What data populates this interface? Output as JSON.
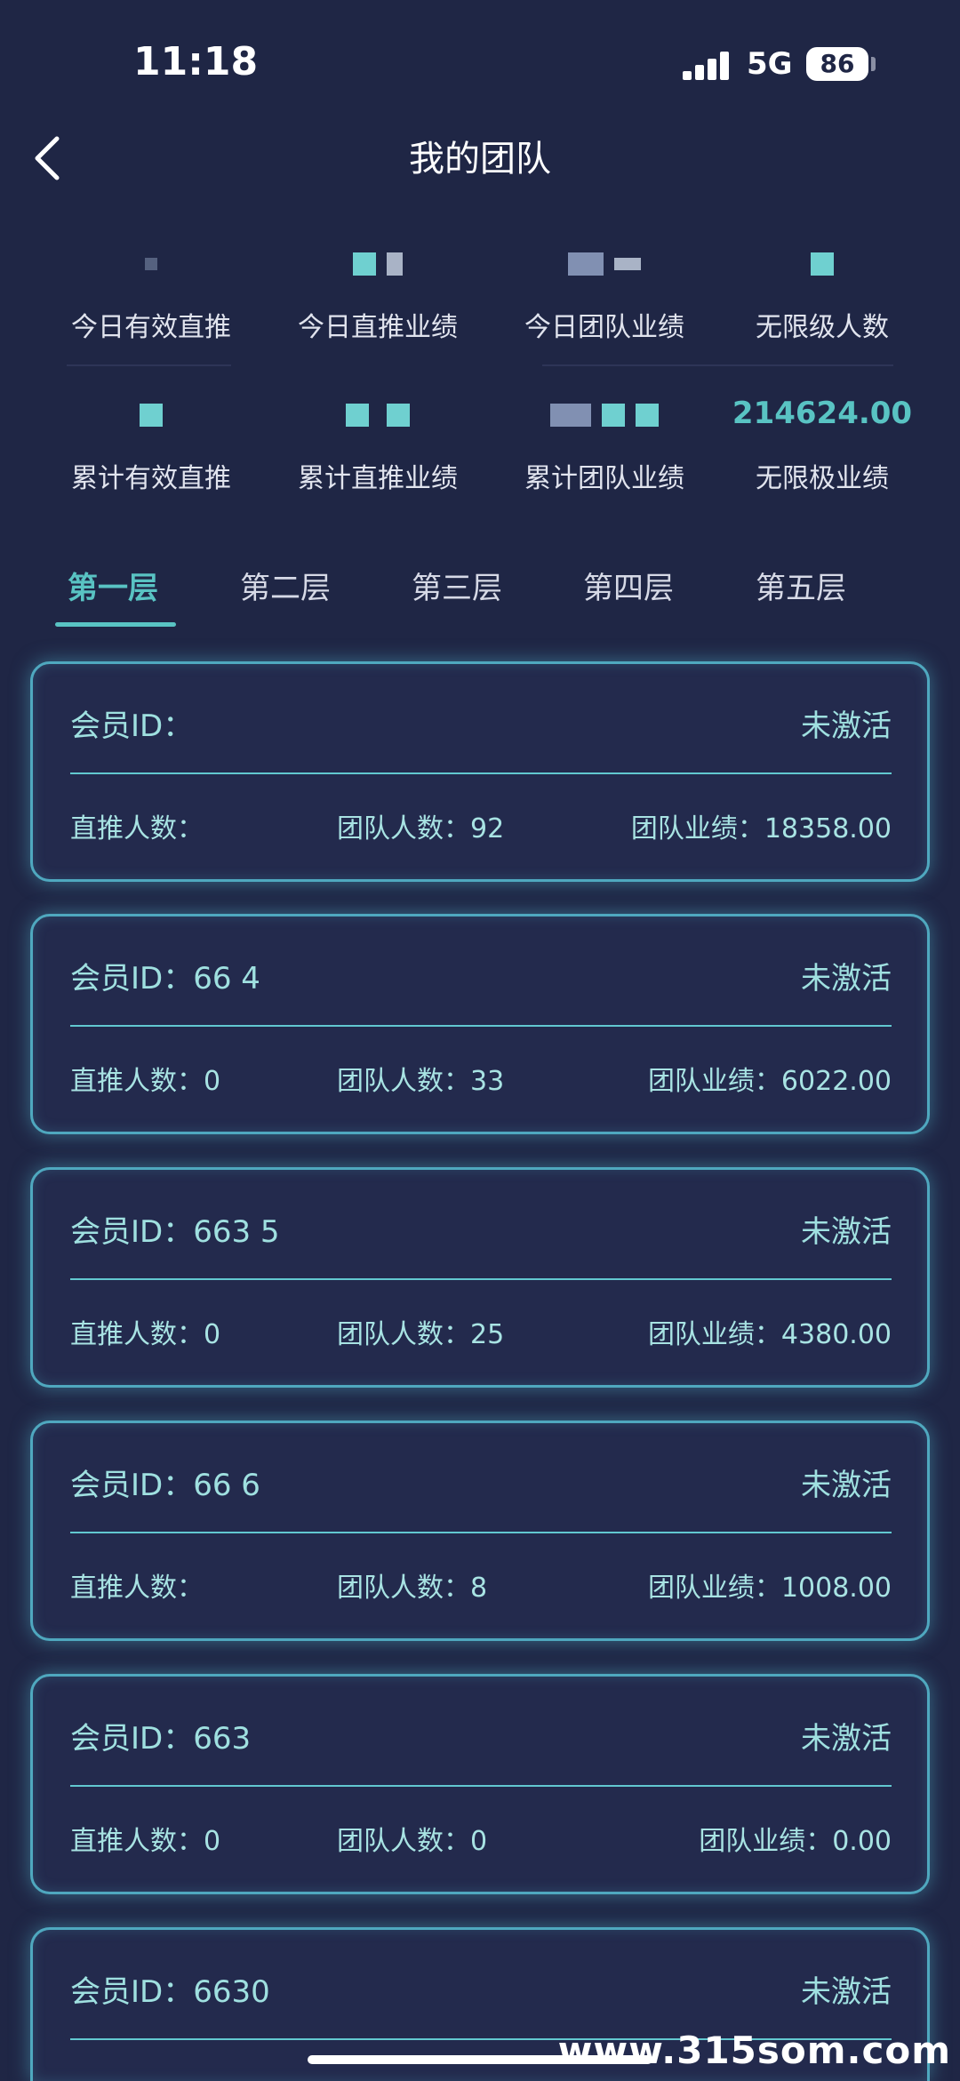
{
  "status_bar": {
    "time": "11:18",
    "network": "5G",
    "battery": "86"
  },
  "nav": {
    "title": "我的团队"
  },
  "stats": {
    "row1": [
      {
        "label": "今日有效直推",
        "value": ""
      },
      {
        "label": "今日直推业绩",
        "value": ""
      },
      {
        "label": "今日团队业绩",
        "value": ""
      },
      {
        "label": "无限级人数",
        "value": ""
      }
    ],
    "row2": [
      {
        "label": "累计有效直推",
        "value": ""
      },
      {
        "label": "累计直推业绩",
        "value": ""
      },
      {
        "label": "累计团队业绩",
        "value": ""
      },
      {
        "label": "无限极业绩",
        "value": "214624.00"
      }
    ]
  },
  "tabs": [
    "第一层",
    "第二层",
    "第三层",
    "第四层",
    "第五层"
  ],
  "cards": [
    {
      "id": "会员ID：",
      "status": "未激活",
      "direct": "直推人数：",
      "team": "团队人数：92",
      "perf": "团队业绩：18358.00"
    },
    {
      "id": "会员ID：66 4",
      "status": "未激活",
      "direct": "直推人数：0",
      "team": "团队人数：33",
      "perf": "团队业绩：6022.00"
    },
    {
      "id": "会员ID：663 5",
      "status": "未激活",
      "direct": "直推人数：0",
      "team": "团队人数：25",
      "perf": "团队业绩：4380.00"
    },
    {
      "id": "会员ID：66 6",
      "status": "未激活",
      "direct": "直推人数：",
      "team": "团队人数：8",
      "perf": "团队业绩：1008.00"
    },
    {
      "id": "会员ID：663",
      "status": "未激活",
      "direct": "直推人数：0",
      "team": "团队人数：0",
      "perf": "团队业绩：0.00"
    },
    {
      "id": "会员ID：6630",
      "status": "未激活",
      "direct": "",
      "team": "",
      "perf": ""
    }
  ],
  "watermark": "www.315som.com",
  "colors": {
    "background": "#1f2645",
    "accent": "#59c3c3",
    "card_border": "#4fa8bf"
  }
}
